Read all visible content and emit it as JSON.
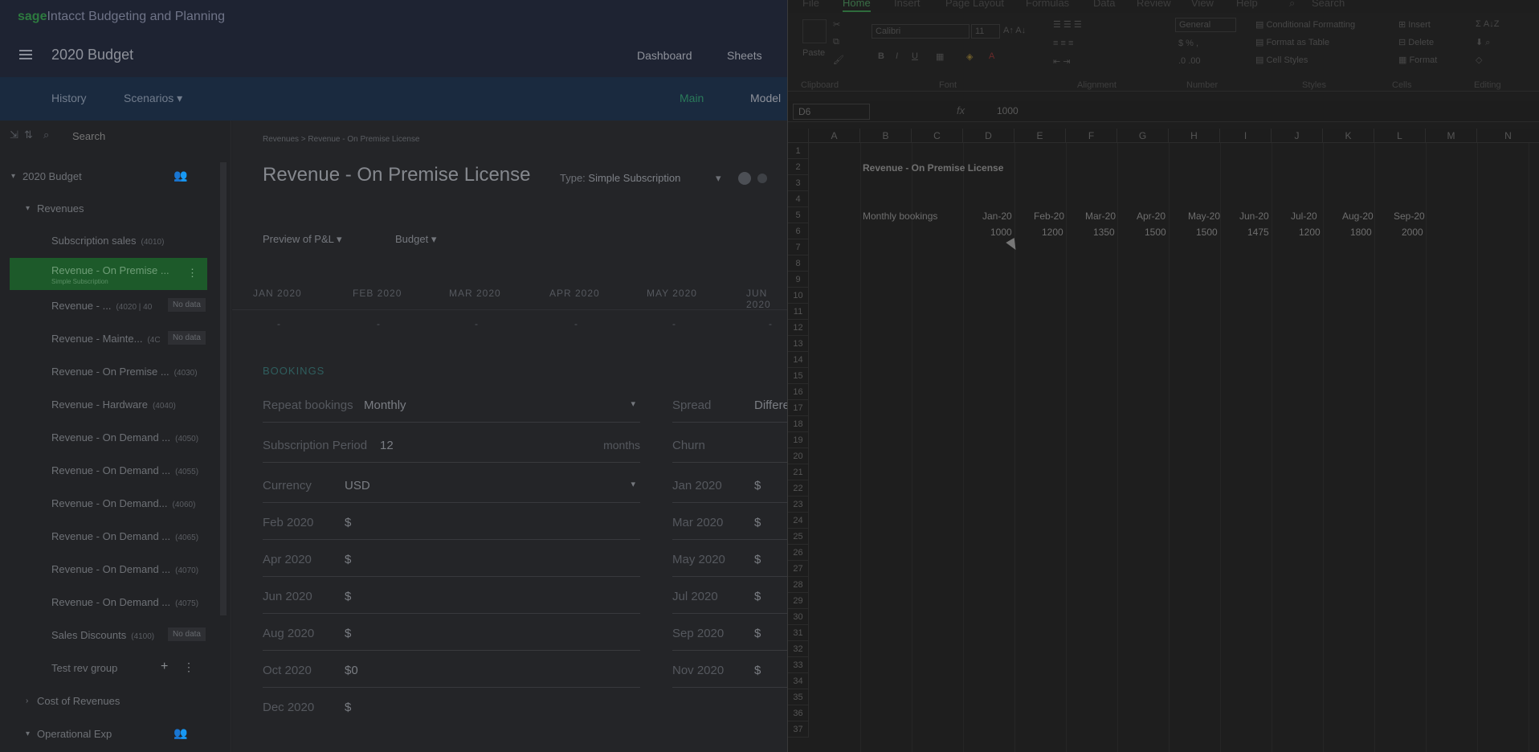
{
  "sage": {
    "brand_sage": "sage",
    "brand_intacct": "Intacct",
    "brand_product": "Budgeting and Planning",
    "app_title": "2020 Budget",
    "top_nav": [
      "Dashboard",
      "Sheets"
    ],
    "sub_nav": {
      "history": "History",
      "scenarios": "Scenarios",
      "main": "Main",
      "model": "Model"
    },
    "search_placeholder": "Search",
    "tree": {
      "root": "2020 Budget",
      "revenues": "Revenues",
      "items": [
        {
          "label": "Subscription sales",
          "code": "(4010)",
          "nodata": ""
        },
        {
          "label": "Revenue - On Premise ...",
          "code": "",
          "nodata": "",
          "sub": "Simple Subscription"
        },
        {
          "label": "Revenue - ...",
          "code": "(4020 | 40",
          "nodata": "No data"
        },
        {
          "label": "Revenue - Mainte...",
          "code": "(4C",
          "nodata": "No data"
        },
        {
          "label": "Revenue - On Premise ...",
          "code": "(4030)",
          "nodata": ""
        },
        {
          "label": "Revenue - Hardware",
          "code": "(4040)",
          "nodata": ""
        },
        {
          "label": "Revenue - On Demand ...",
          "code": "(4050)",
          "nodata": ""
        },
        {
          "label": "Revenue - On Demand ...",
          "code": "(4055)",
          "nodata": ""
        },
        {
          "label": "Revenue - On Demand...",
          "code": "(4060)",
          "nodata": ""
        },
        {
          "label": "Revenue - On Demand ...",
          "code": "(4065)",
          "nodata": ""
        },
        {
          "label": "Revenue - On Demand ...",
          "code": "(4070)",
          "nodata": ""
        },
        {
          "label": "Revenue - On Demand ...",
          "code": "(4075)",
          "nodata": ""
        },
        {
          "label": "Sales Discounts",
          "code": "(4100)",
          "nodata": "No data"
        },
        {
          "label": "Test rev group",
          "code": "",
          "nodata": ""
        }
      ],
      "cost": "Cost of Revenues",
      "opex": "Operational Exp"
    },
    "main": {
      "breadcrumb": "Revenues > Revenue - On Premise License",
      "title": "Revenue - On Premise License",
      "type_label": "Type:",
      "type_value": "Simple Subscription",
      "preview": "Preview of P&L",
      "budget": "Budget",
      "months": [
        "JAN 2020",
        "FEB 2020",
        "MAR 2020",
        "APR 2020",
        "MAY 2020",
        "JUN 2020"
      ],
      "month_vals": [
        "-",
        "-",
        "-",
        "-",
        "-",
        "-"
      ],
      "section": "BOOKINGS",
      "repeat_label": "Repeat bookings",
      "repeat_value": "Monthly",
      "spread_label": "Spread",
      "spread_value": "Differe",
      "period_label": "Subscription Period",
      "period_value": "12",
      "period_unit": "months",
      "churn_label": "Churn",
      "currency_label": "Currency",
      "currency_value": "USD",
      "left_fields": [
        {
          "label": "Feb 2020",
          "value": "$"
        },
        {
          "label": "Apr 2020",
          "value": "$"
        },
        {
          "label": "Jun 2020",
          "value": "$"
        },
        {
          "label": "Aug 2020",
          "value": "$"
        },
        {
          "label": "Oct 2020",
          "value": "$0"
        },
        {
          "label": "Dec 2020",
          "value": "$"
        }
      ],
      "right_fields": [
        {
          "label": "Jan 2020",
          "value": "$"
        },
        {
          "label": "Mar 2020",
          "value": "$"
        },
        {
          "label": "May 2020",
          "value": "$"
        },
        {
          "label": "Jul 2020",
          "value": "$"
        },
        {
          "label": "Sep 2020",
          "value": "$"
        },
        {
          "label": "Nov 2020",
          "value": "$"
        }
      ]
    }
  },
  "excel": {
    "tabs": [
      "File",
      "Home",
      "Insert",
      "Page Layout",
      "Formulas",
      "Data",
      "Review",
      "View",
      "Help"
    ],
    "search": "Search",
    "groups": {
      "clipboard": "Clipboard",
      "font": "Font",
      "alignment": "Alignment",
      "number": "Number",
      "styles": "Styles",
      "cells": "Cells",
      "editing": "Editing"
    },
    "paste": "Paste",
    "font_name": "Calibri",
    "font_size": "11",
    "number_format": "General",
    "styles": [
      "Conditional Formatting",
      "Format as Table",
      "Cell Styles"
    ],
    "cells": [
      "Insert",
      "Delete",
      "Format"
    ],
    "name_box": "D6",
    "fx": "fx",
    "formula_value": "1000",
    "columns": [
      "A",
      "B",
      "C",
      "D",
      "E",
      "F",
      "G",
      "H",
      "I",
      "J",
      "K",
      "L",
      "M",
      "N"
    ],
    "rows": [
      "1",
      "2",
      "3",
      "4",
      "5",
      "6",
      "7",
      "8",
      "9",
      "10",
      "11",
      "12",
      "13",
      "14",
      "15",
      "16",
      "17",
      "18",
      "19",
      "20",
      "21",
      "22",
      "23",
      "24",
      "25",
      "26",
      "27",
      "28",
      "29",
      "30",
      "31",
      "32",
      "33",
      "34",
      "35",
      "36",
      "37"
    ],
    "sheet_title": "Revenue - On Premise License",
    "row5_label": "Monthly bookings",
    "row5_months": [
      "Jan-20",
      "Feb-20",
      "Mar-20",
      "Apr-20",
      "May-20",
      "Jun-20",
      "Jul-20",
      "Aug-20",
      "Sep-20"
    ],
    "row6_values": [
      "1000",
      "1200",
      "1350",
      "1500",
      "1500",
      "1475",
      "1200",
      "1800",
      "2000"
    ]
  }
}
